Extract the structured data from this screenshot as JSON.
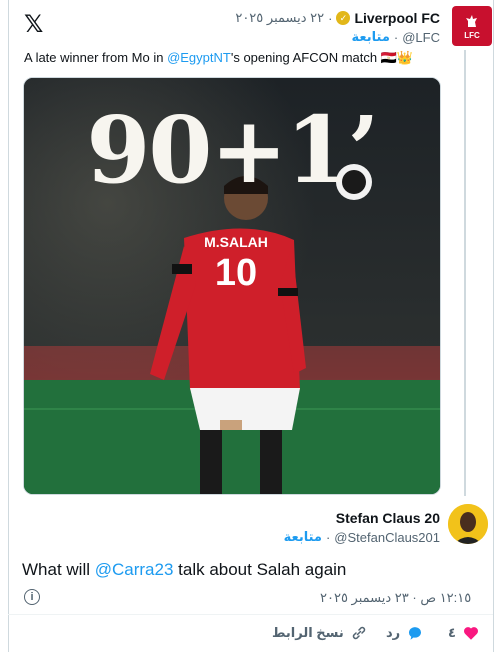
{
  "header": {
    "logo": "𝕏"
  },
  "tweet": {
    "author_name": "Liverpool FC",
    "handle": "@LFC",
    "date": "٢٢ ديسمبر ٢٠٢٥",
    "follow_label": "متابعة",
    "dot": "·",
    "avatar_text": "LFC",
    "text_before": "A late winner from Mo in ",
    "text_link": "@EgyptNT",
    "text_after": "'s opening AFCON match 🇪🇬👑",
    "media": {
      "big_text": "90+1’",
      "shirt_name": "M.SALAH",
      "shirt_number": "10"
    }
  },
  "reply": {
    "author_name": "Stefan Claus 20",
    "handle": "@StefanClaus201",
    "follow_label": "متابعة",
    "dot": "·",
    "text_before": "What will ",
    "text_link": "@Carra23",
    "text_after": " talk about Salah again",
    "time": "١٢:١٥ ص",
    "date": "٢٣ ديسمبر ٢٠٢٥",
    "info_glyph": "i"
  },
  "actions": {
    "like_count": "٤",
    "reply_label": "رد",
    "copy_label": "نسخ الرابط"
  },
  "colors": {
    "accent": "#1d9bf0",
    "like": "#f91880",
    "lfc_red": "#c8102e",
    "verified": "#e2b719"
  }
}
